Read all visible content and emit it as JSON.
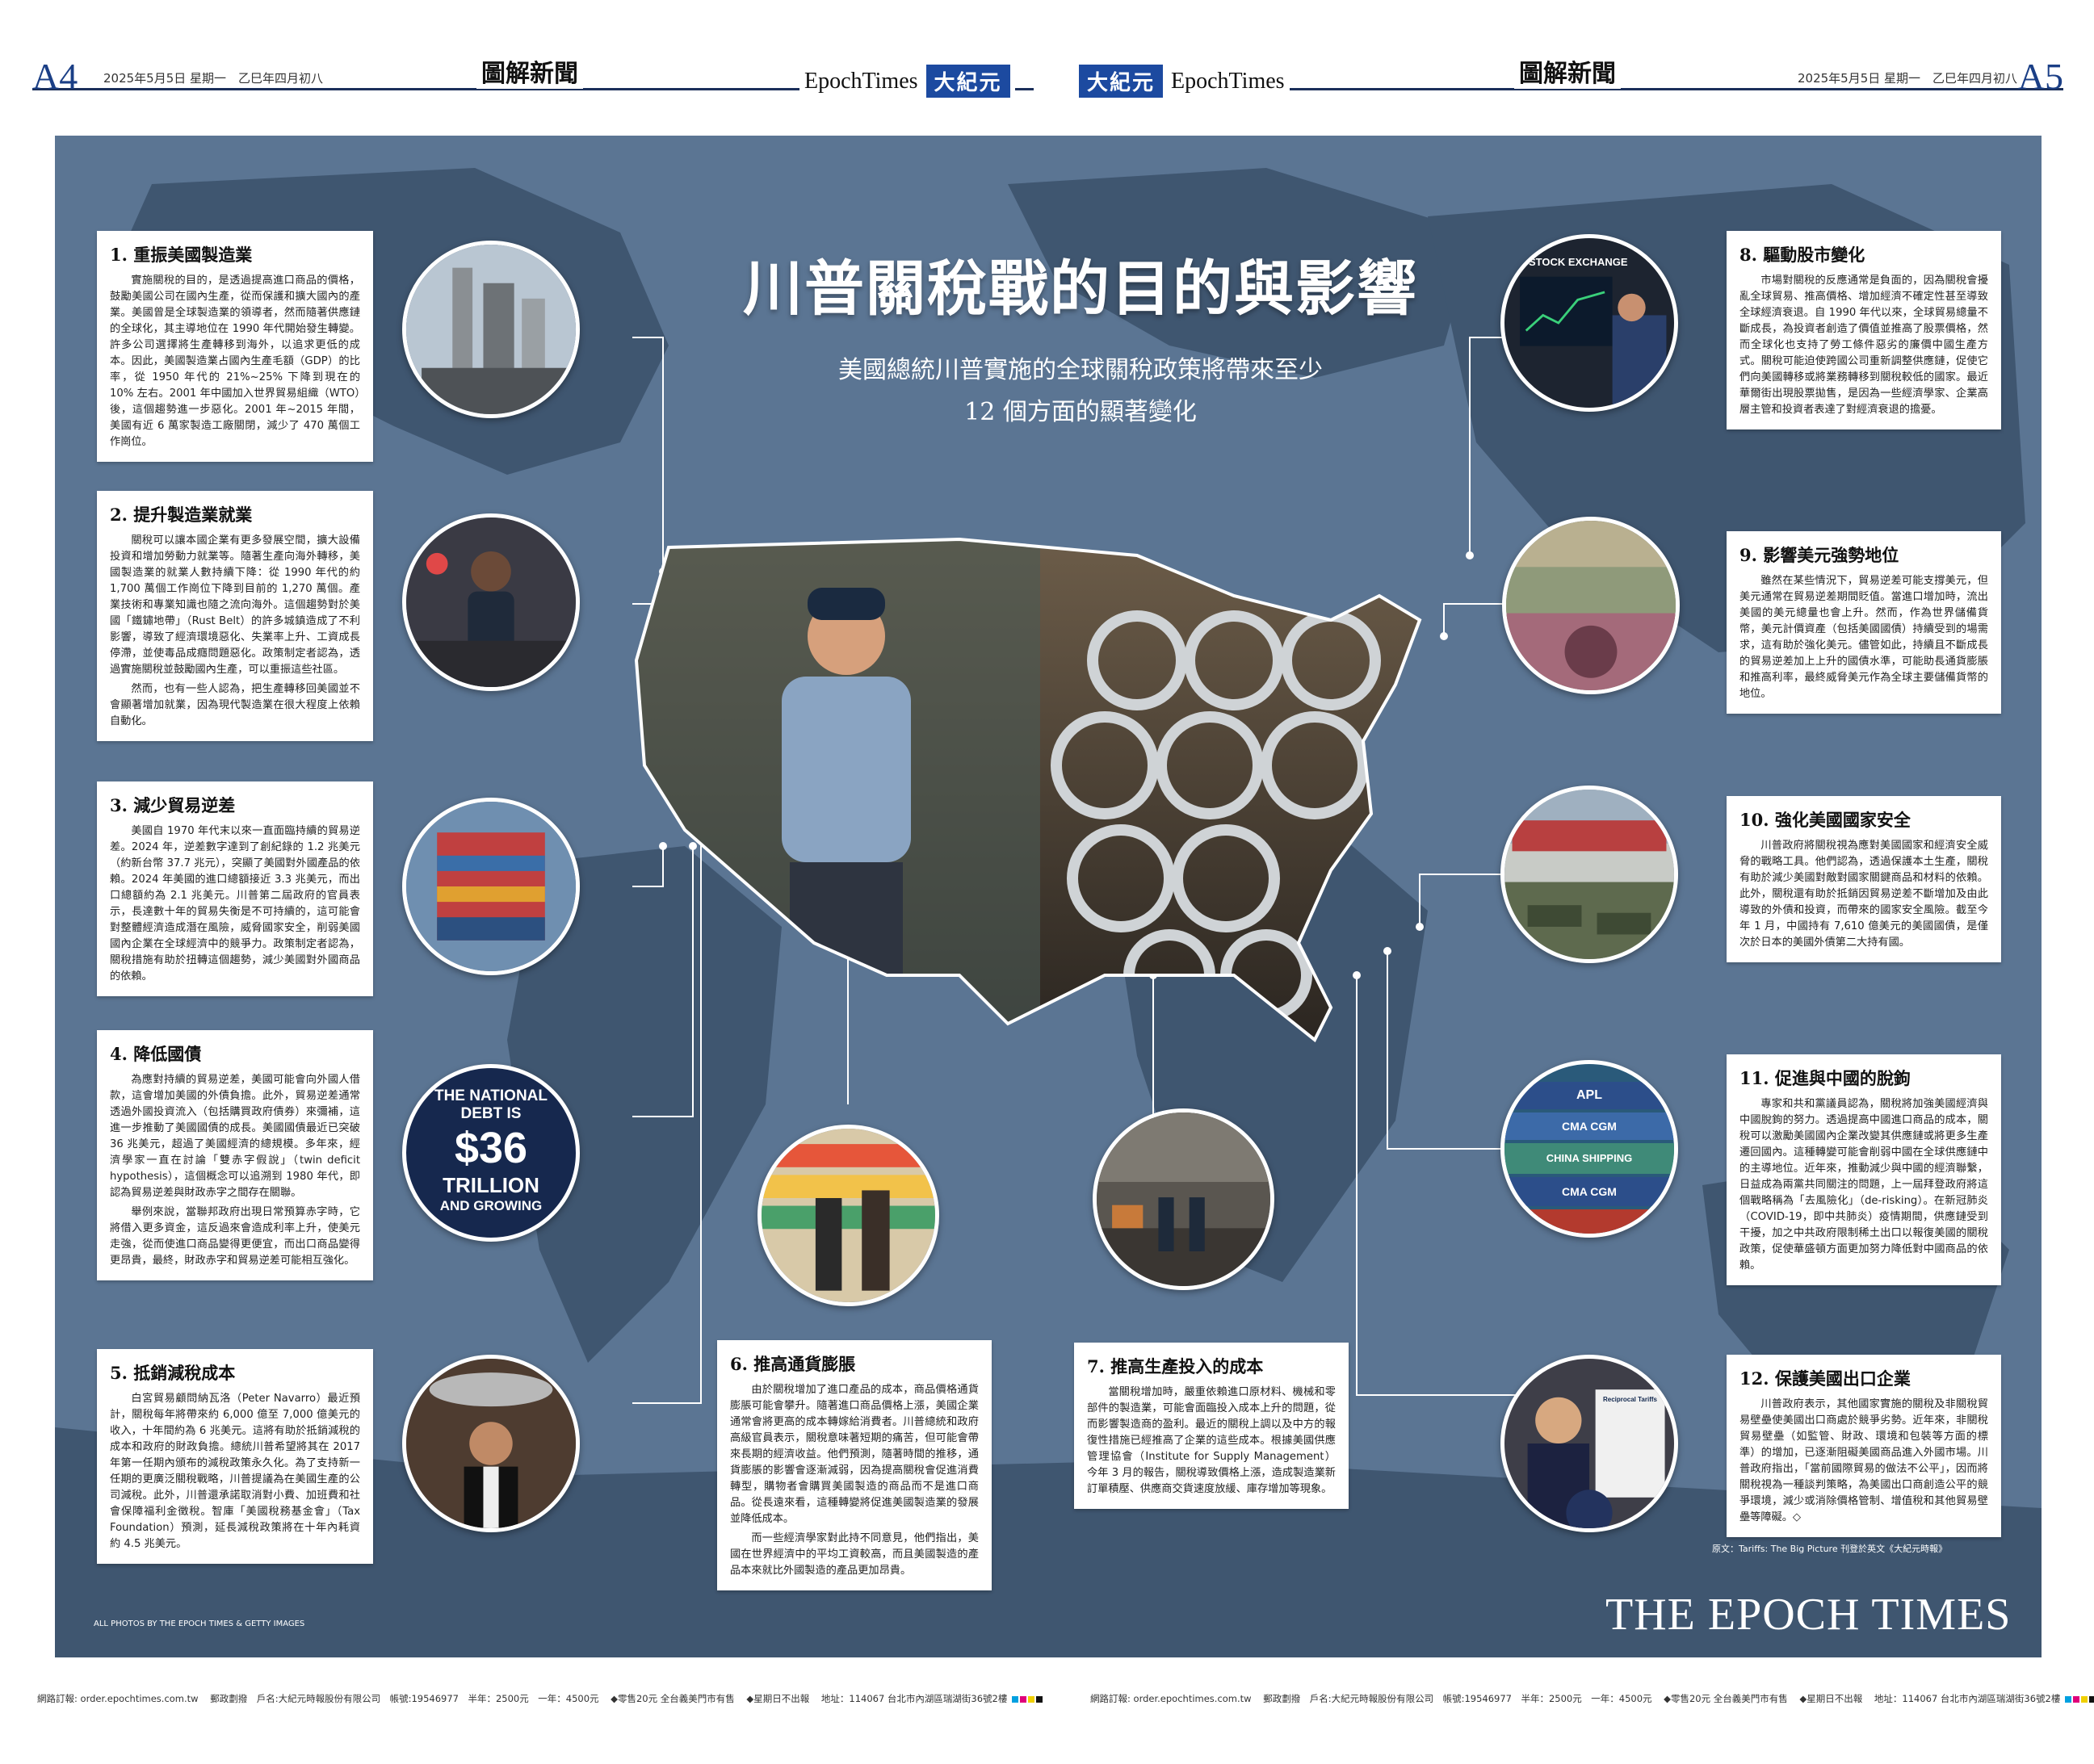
{
  "masthead": {
    "left_page": "A4",
    "right_page": "A5",
    "date": "2025年5月5日 星期一　乙巳年四月初八",
    "section": "圖解新聞",
    "brand_en": "EpochTimes",
    "brand_zh": "大紀元"
  },
  "headline": {
    "title": "川普關稅戰的目的與影響",
    "subtitle_line1": "美國總統川普實施的全球關稅政策將帶來至少",
    "subtitle_line2": "12 個方面的顯著變化"
  },
  "items": [
    {
      "heading": "1. 重振美國製造業",
      "paragraphs": [
        "實施關稅的目的，是透過提高進口商品的價格，鼓勵美國公司在國內生產，從而保護和擴大國內的產業。美國曾是全球製造業的領導者，然而隨著供應鏈的全球化，其主導地位在 1990 年代開始發生轉變。許多公司選擇將生產轉移到海外，以追求更低的成本。因此，美國製造業占國內生產毛額（GDP）的比率，從 1950 年代的 21%~25% 下降到現在的 10% 左右。2001 年中國加入世界貿易組織（WTO）後，這個趨勢進一步惡化。2001 年~2015 年間，美國有近 6 萬家製造工廠關閉，減少了 470 萬個工作崗位。"
      ]
    },
    {
      "heading": "2. 提升製造業就業",
      "paragraphs": [
        "關稅可以讓本國企業有更多發展空間，擴大設備投資和增加勞動力就業等。隨著生產向海外轉移，美國製造業的就業人數持續下降：從 1990 年代的約 1,700 萬個工作崗位下降到目前的 1,270 萬個。產業技術和專業知識也隨之流向海外。這個趨勢對於美國「鐵鏽地帶」（Rust Belt）的許多城鎮造成了不利影響，導致了經濟環境惡化、失業率上升、工資成長停滯，並使毒品成癮問題惡化。政策制定者認為，透過實施關稅並鼓勵國內生產，可以重振這些社區。",
        "然而，也有一些人認為，把生產轉移回美國並不會顯著增加就業，因為現代製造業在很大程度上依賴自動化。"
      ]
    },
    {
      "heading": "3. 減少貿易逆差",
      "paragraphs": [
        "美國自 1970 年代末以來一直面臨持續的貿易逆差。2024 年，逆差數字達到了創紀錄的 1.2 兆美元（約新台幣 37.7 兆元），突顯了美國對外國產品的依賴。2024 年美國的進口總額接近 3.3 兆美元，而出口總額約為 2.1 兆美元。川普第二屆政府的官員表示，長達數十年的貿易失衡是不可持續的，這可能會對整體經濟造成潛在風險，威脅國家安全，削弱美國國內企業在全球經濟中的競爭力。政策制定者認為，關稅措施有助於扭轉這個趨勢，減少美國對外國商品的依賴。"
      ]
    },
    {
      "heading": "4. 降低國債",
      "paragraphs": [
        "為應對持續的貿易逆差，美國可能會向外國人借款，這會增加美國的外債負擔。此外，貿易逆差通常透過外國投資流入（包括購買政府債券）來彌補，這進一步推動了美國國債的成長。美國國債最近已突破 36 兆美元，超過了美國經濟的總規模。多年來，經濟學家一直在討論「雙赤字假說」（twin deficit hypothesis），這個概念可以追溯到 1980 年代，即認為貿易逆差與財政赤字之間存在關聯。",
        "舉例來說，當聯邦政府出現日常預算赤字時，它將借入更多資金，這反過來會造成利率上升，使美元走強，從而使進口商品變得更便宜，而出口商品變得更昂貴，最終，財政赤字和貿易逆差可能相互強化。"
      ]
    },
    {
      "heading": "5. 抵銷減稅成本",
      "paragraphs": [
        "白宮貿易顧問納瓦洛（Peter Navarro）最近預計，關稅每年將帶來約 6,000 億至 7,000 億美元的收入，十年間約為 6 兆美元。這將有助於抵銷減稅的成本和政府的財政負擔。總統川普希望將其在 2017 年第一任期內頒布的減稅政策永久化。為了支持新一任期的更廣泛關稅戰略，川普提議為在美國生產的公司減稅。此外，川普還承諾取消對小費、加班費和社會保障福利金徵稅。智庫「美國稅務基金會」（Tax Foundation）預測，延長減稅政策將在十年內耗資約 4.5 兆美元。"
      ]
    },
    {
      "heading": "6. 推高通貨膨脹",
      "paragraphs": [
        "由於關稅增加了進口產品的成本，商品價格通貨膨脹可能會攀升。隨著進口商品價格上漲，美國企業通常會將更高的成本轉嫁給消費者。川普總統和政府高級官員表示，關稅意味著短期的痛苦，但可能會帶來長期的經濟收益。他們預測，隨著時間的推移，通貨膨脹的影響會逐漸減弱，因為提高關稅會促進消費轉型，購物者會購買美國製造的商品而不是進口商品。從長遠來看，這種轉變將促進美國製造業的發展並降低成本。",
        "而一些經濟學家對此持不同意見，他們指出，美國在世界經濟中的平均工資較高，而且美國製造的產品本來就比外國製造的產品更加昂貴。"
      ]
    },
    {
      "heading": "7. 推高生產投入的成本",
      "paragraphs": [
        "當關稅增加時，嚴重依賴進口原材料、機械和零部件的製造業，可能會面臨投入成本上升的問題，從而影響製造商的盈利。最近的關稅上調以及中方的報復性措施已經推高了企業的這些成本。根據美國供應管理協會（Institute for Supply Management）今年 3 月的報告，關稅導致價格上漲，造成製造業新訂單積壓、供應商交貨速度放緩、庫存增加等現象。"
      ]
    },
    {
      "heading": "8. 驅動股市變化",
      "paragraphs": [
        "市場對關稅的反應通常是負面的，因為關稅會擾亂全球貿易、推高價格、增加經濟不確定性甚至導致全球經濟衰退。自 1990 年代以來，全球貿易總量不斷成長，為投資者創造了價值並推高了股票價格，然而全球化也支持了勞工條件惡劣的廉價中國生產方式。關稅可能迫使跨國公司重新調整供應鏈，促使它們向美國轉移或將業務轉移到關稅較低的國家。最近華爾街出現股票拋售，是因為一些經濟學家、企業高層主管和投資者表達了對經濟衰退的擔憂。"
      ]
    },
    {
      "heading": "9. 影響美元強勢地位",
      "paragraphs": [
        "雖然在某些情況下，貿易逆差可能支撐美元，但美元通常在貿易逆差期間貶值。當進口增加時，流出美國的美元總量也會上升。然而，作為世界儲備貨幣，美元計價資產（包括美國國債）持續受到的場需求，這有助於強化美元。儘管如此，持續且不斷成長的貿易逆差加上上升的國債水準，可能助長通貨膨脹和推高利率，最終威脅美元作為全球主要儲備貨幣的地位。"
      ]
    },
    {
      "heading": "10. 強化美國國家安全",
      "paragraphs": [
        "川普政府將關稅視為應對美國國家和經濟安全威脅的戰略工具。他們認為，透過保護本土生產，關稅有助於減少美國對敵對國家關鍵商品和材料的依賴。此外，關稅還有助於抵銷因貿易逆差不斷增加及由此導致的外債和投資，而帶來的國家安全風險。截至今年 1 月，中國持有 7,610 億美元的美國國債，是僅次於日本的美國外債第二大持有國。"
      ]
    },
    {
      "heading": "11. 促進與中國的脫鉤",
      "paragraphs": [
        "專家和共和黨議員認為，關稅將加強美國經濟與中國脫鉤的努力。透過提高中國進口商品的成本，關稅可以激勵美國國內企業改變其供應鏈或將更多生產遷回國內。這種轉變可能會削弱中國在全球供應鏈中的主導地位。近年來，推動減少與中國的經濟聯繫，日益成為兩黨共同關注的問題，上一屆拜登政府將這個戰略稱為「去風險化」（de-risking）。在新冠肺炎（COVID-19，即中共肺炎）疫情期間，供應鏈受到干擾，加之中共政府限制稀土出口以報復美國的關稅政策，促使華盛頓方面更加努力降低對中國商品的依賴。"
      ]
    },
    {
      "heading": "12. 保護美國出口企業",
      "paragraphs": [
        "川普政府表示，其他國家實施的關稅及非關稅貿易壁壘使美國出口商處於競爭劣勢。近年來，非關稅貿易壁壘（如監管、財政、環境和包裝等方面的標準）的增加，已逐漸阻礙美國商品進入外國市場。川普政府指出，「當前國際貿易的做法不公平」，因而將關稅視為一種談判策略，為美國出口商創造公平的競爭環境，減少或消除價格管制、增值稅和其他貿易壁壘等障礙。◇"
      ]
    }
  ],
  "photo_text": {
    "stock_exchange": "STOCK EXCHANGE",
    "debt_line1": "THE NATIONAL",
    "debt_line2": "DEBT IS",
    "debt_amount": "$36",
    "debt_line3": "TRILLION",
    "debt_line4": "AND GROWING",
    "container_brands": [
      "APL",
      "CMA CGM",
      "CHINA SHIPPING",
      "CMA CGM"
    ],
    "tariff_board": "Reciprocal Tariffs"
  },
  "credits": {
    "photos": "ALL PHOTOS BY THE EPOCH TIMES & GETTY IMAGES",
    "source": "原文：Tariffs: The Big Picture 刊登於英文《大紀元時報》",
    "logo": "THE EPOCH TIMES"
  },
  "footer": {
    "order": "網路訂報: order.epochtimes.com.tw",
    "postal": "郵政劃撥　戶名:大紀元時報股份有限公司　帳號:19546977　半年：2500元　一年：4500元",
    "retail": "◆零售20元 全台義美門市有售",
    "holiday": "◆星期日不出報",
    "address": "地址：114067 台北市內湖區瑞湖街36號2樓"
  },
  "colors": {
    "panel_bg": "#5b7593",
    "land": "#3f5670",
    "accent_blue": "#1c4aa0"
  }
}
